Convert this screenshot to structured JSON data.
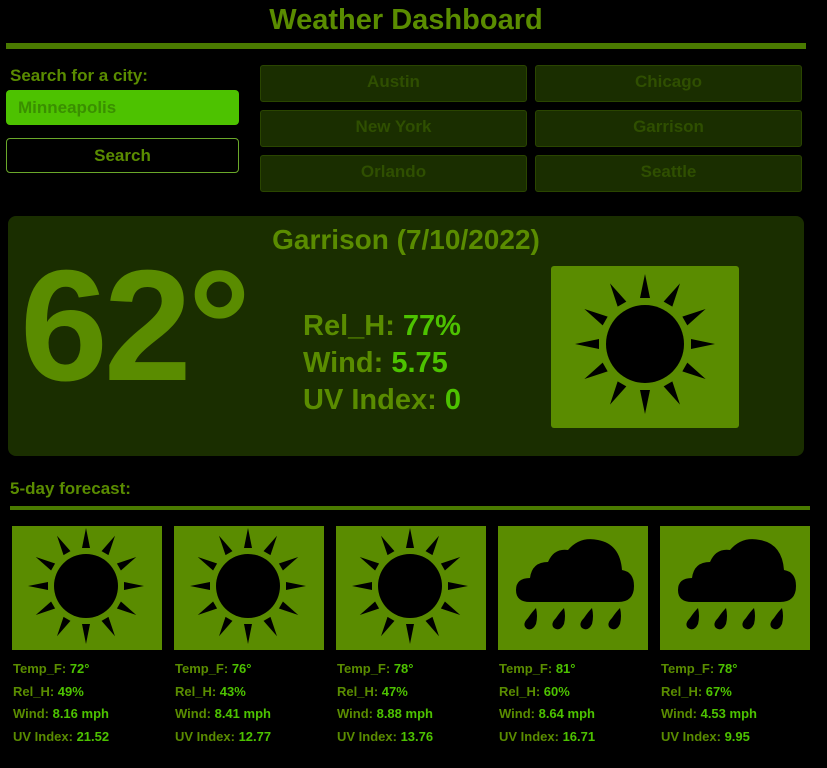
{
  "header": {
    "title": "Weather Dashboard"
  },
  "search": {
    "label": "Search for a city:",
    "value": "Minneapolis",
    "button_label": "Search"
  },
  "cities": [
    "Austin",
    "Chicago",
    "New York",
    "Garrison",
    "Orlando",
    "Seattle"
  ],
  "current": {
    "title": "Garrison (7/10/2022)",
    "temp": "62°",
    "humidity_label": "Rel_H: ",
    "humidity": "77%",
    "wind_label": "Wind: ",
    "wind": "5.75",
    "uv_label": "UV Index: ",
    "uv": "0",
    "icon": "sun-icon"
  },
  "forecast": {
    "label": "5-day forecast:",
    "labels": {
      "temp": "Temp_F: ",
      "hum": "Rel_H: ",
      "wind": "Wind: ",
      "uv": "UV Index: "
    },
    "days": [
      {
        "icon": "sun-icon",
        "temp": "72°",
        "hum": "49%",
        "wind": "8.16 mph",
        "uv": "21.52"
      },
      {
        "icon": "sun-icon",
        "temp": "76°",
        "hum": "43%",
        "wind": "8.41 mph",
        "uv": "12.77"
      },
      {
        "icon": "sun-icon",
        "temp": "78°",
        "hum": "47%",
        "wind": "8.88 mph",
        "uv": "13.76"
      },
      {
        "icon": "rain-icon",
        "temp": "81°",
        "hum": "60%",
        "wind": "8.64 mph",
        "uv": "16.71"
      },
      {
        "icon": "rain-icon",
        "temp": "78°",
        "hum": "67%",
        "wind": "4.53 mph",
        "uv": "9.95"
      }
    ]
  },
  "colors": {
    "accent": "#5a8c00",
    "bright": "#4dc200",
    "panel": "#1a2e00",
    "background": "#000000"
  }
}
